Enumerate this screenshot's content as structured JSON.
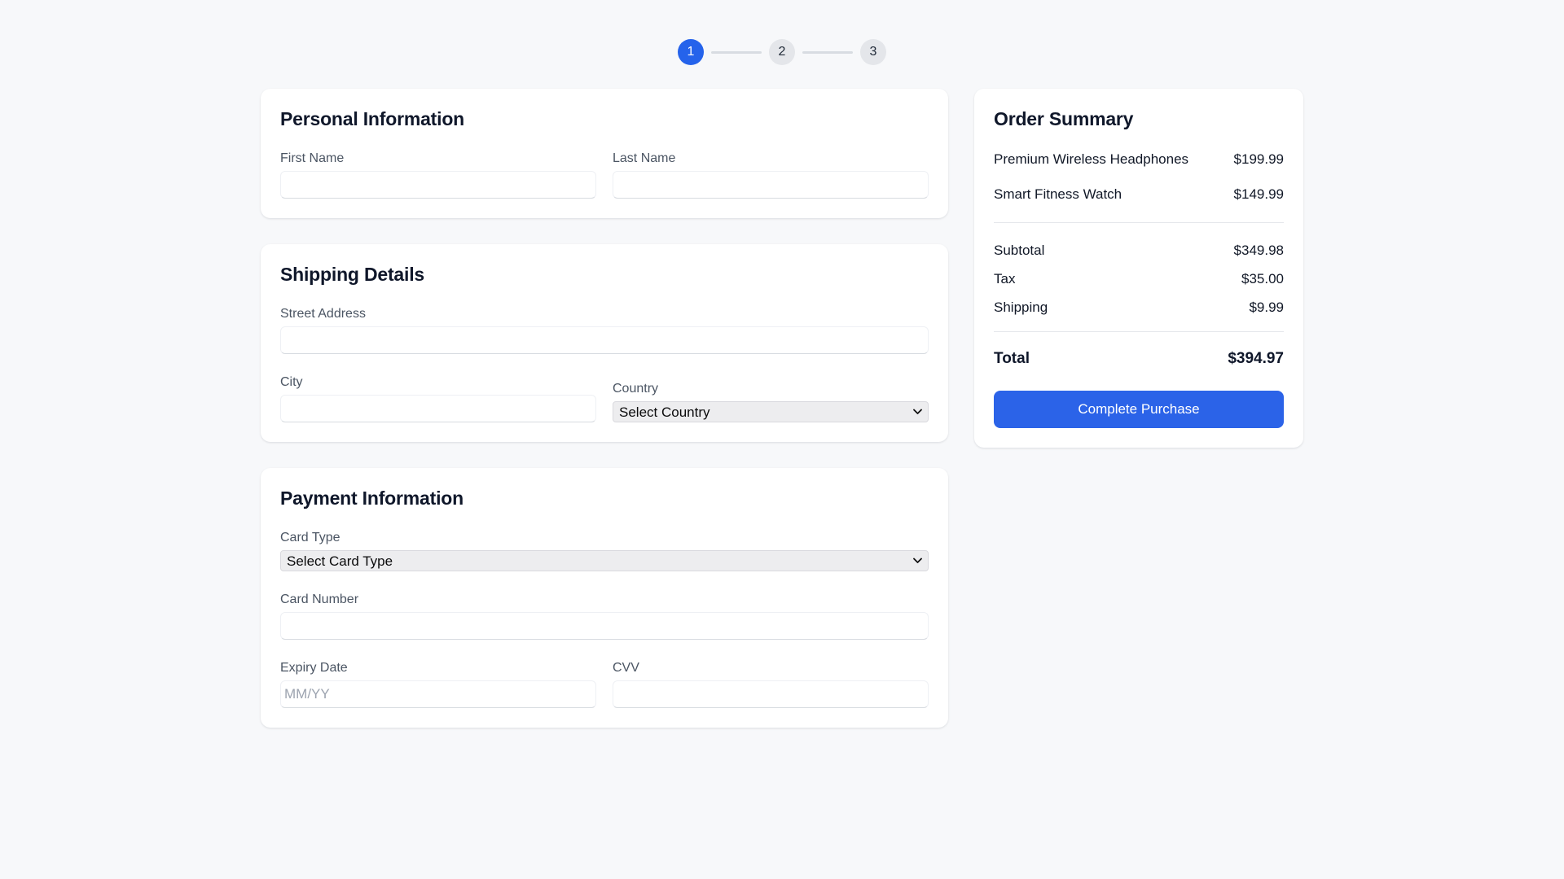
{
  "colors": {
    "accent": "#2b63e8",
    "page_background": "#f7f8fa",
    "card_background": "#ffffff",
    "inactive_step": "#e4e6ea",
    "placeholder": "#9ca3af"
  },
  "stepper": {
    "steps": [
      "1",
      "2",
      "3"
    ],
    "active_step": "1"
  },
  "personal": {
    "title": "Personal Information",
    "first_name": {
      "label": "First Name",
      "value": ""
    },
    "last_name": {
      "label": "Last Name",
      "value": ""
    }
  },
  "shipping": {
    "title": "Shipping Details",
    "street": {
      "label": "Street Address",
      "value": ""
    },
    "city": {
      "label": "City",
      "value": ""
    },
    "country": {
      "label": "Country",
      "selected_option": "Select Country"
    }
  },
  "payment": {
    "title": "Payment Information",
    "card_type": {
      "label": "Card Type",
      "selected_option": "Select Card Type"
    },
    "card_number": {
      "label": "Card Number",
      "value": ""
    },
    "expiry": {
      "label": "Expiry Date",
      "value": "",
      "placeholder": "MM/YY"
    },
    "cvv": {
      "label": "CVV",
      "value": ""
    }
  },
  "summary": {
    "title": "Order Summary",
    "items": [
      {
        "name": "Premium Wireless Headphones",
        "price": "$199.99"
      },
      {
        "name": "Smart Fitness Watch",
        "price": "$149.99"
      }
    ],
    "totals": [
      {
        "label": "Subtotal",
        "value": "$349.98"
      },
      {
        "label": "Tax",
        "value": "$35.00"
      },
      {
        "label": "Shipping",
        "value": "$9.99"
      }
    ],
    "total": {
      "label": "Total",
      "value": "$394.97"
    },
    "cta_label": "Complete Purchase"
  }
}
